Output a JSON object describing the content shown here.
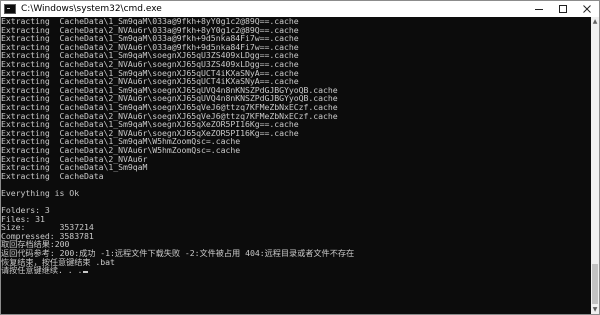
{
  "window": {
    "title": "C:\\Windows\\system32\\cmd.exe",
    "icon": "cmd-icon"
  },
  "controls": {
    "minimize": "minimize-icon",
    "maximize": "maximize-icon",
    "close": "close-icon"
  },
  "console": {
    "lines": [
      "Extracting  CacheData\\1_Sm9qaM\\033a@9fkh+8yY0g1c2@89Q==.cache",
      "Extracting  CacheData\\2_NVAu6r\\033a@9fkh+8yY0g1c2@89Q==.cache",
      "Extracting  CacheData\\1_Sm9qaM\\033a@9fkh+9d5nka84Fi7w==.cache",
      "Extracting  CacheData\\2_NVAu6r\\033a@9fkh+9d5nka84Fi7w==.cache",
      "Extracting  CacheData\\1_Sm9qaM\\soegnXJ65qU3ZS409xLDgg==.cache",
      "Extracting  CacheData\\2_NVAu6r\\soegnXJ65qU3ZS409xLDgg==.cache",
      "Extracting  CacheData\\1_Sm9qaM\\soegnXJ65qUCT4iKXaSNyA==.cache",
      "Extracting  CacheData\\2_NVAu6r\\soegnXJ65qUCT4iKXaSNyA==.cache",
      "Extracting  CacheData\\1_Sm9qaM\\soegnXJ65qUVQ4n8nKNSZPdGJBGYyoQB.cache",
      "Extracting  CacheData\\2_NVAu6r\\soegnXJ65qUVQ4n8nKNSZPdGJBGYyoQB.cache",
      "Extracting  CacheData\\1_Sm9qaM\\soegnXJ65qVeJ6@ttzq7KFMeZbNxECzf.cache",
      "Extracting  CacheData\\2_NVAu6r\\soegnXJ65qVeJ6@ttzq7KFMeZbNxECzf.cache",
      "Extracting  CacheData\\1_Sm9qaM\\soegnXJ65qXeZOR5PI16Kg==.cache",
      "Extracting  CacheData\\2_NVAu6r\\soegnXJ65qXeZOR5PI16Kg==.cache",
      "Extracting  CacheData\\1_Sm9qaM\\W5hmZoomQsc=.cache",
      "Extracting  CacheData\\2_NVAu6r\\W5hmZoomQsc=.cache",
      "Extracting  CacheData\\2_NVAu6r",
      "Extracting  CacheData\\1_Sm9qaM",
      "Extracting  CacheData",
      "",
      "Everything is Ok",
      "",
      "Folders: 3",
      "Files: 31",
      "Size:       3537214",
      "Compressed: 3583781",
      "取回存档结果:200",
      "返回代码参考: 200:成功 -1:远程文件下载失败 -2:文件被占用 404:远程目录或者文件不存在",
      "恢复结束，按任意键结束 .bat",
      "请按任意键继续. . ."
    ]
  }
}
